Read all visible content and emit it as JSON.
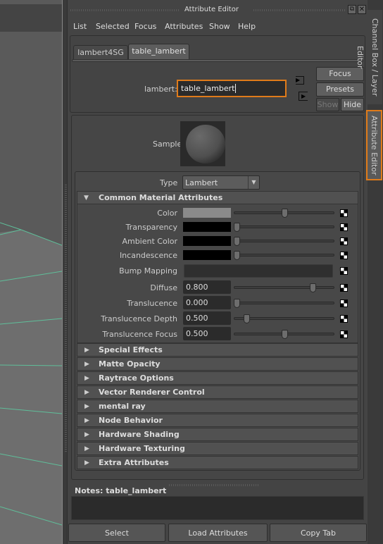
{
  "window": {
    "title": "Attribute Editor"
  },
  "menu": [
    "List",
    "Selected",
    "Focus",
    "Attributes",
    "Show",
    "Help"
  ],
  "tabs": [
    {
      "label": "lambert4SG",
      "active": false
    },
    {
      "label": "table_lambert",
      "active": true
    }
  ],
  "node": {
    "label": "lambert:",
    "value": "table_lambert"
  },
  "side_buttons": {
    "focus": "Focus",
    "presets": "Presets",
    "show": "Show",
    "hide": "Hide"
  },
  "sample": {
    "label": "Sample"
  },
  "type": {
    "label": "Type",
    "value": "Lambert"
  },
  "common": {
    "title": "Common Material Attributes",
    "expanded": true,
    "attributes": [
      {
        "label": "Color",
        "kind": "color",
        "swatch": "#8a8a8a",
        "slider": 0.5
      },
      {
        "label": "Transparency",
        "kind": "color",
        "swatch": "#000000",
        "slider": 0
      },
      {
        "label": "Ambient Color",
        "kind": "color",
        "swatch": "#000000",
        "slider": 0
      },
      {
        "label": "Incandescence",
        "kind": "color",
        "swatch": "#000000",
        "slider": 0
      },
      {
        "label": "Bump Mapping",
        "kind": "map"
      },
      {
        "label": "Diffuse",
        "kind": "number",
        "value": "0.800",
        "slider": 0.8
      },
      {
        "label": "Translucence",
        "kind": "number",
        "value": "0.000",
        "slider": 0
      },
      {
        "label": "Translucence Depth",
        "kind": "number",
        "value": "0.500",
        "slider": 0.1
      },
      {
        "label": "Translucence Focus",
        "kind": "number",
        "value": "0.500",
        "slider": 0.5
      }
    ]
  },
  "sections": [
    "Special Effects",
    "Matte Opacity",
    "Raytrace Options",
    "Vector Renderer Control",
    "mental ray",
    "Node Behavior",
    "Hardware Shading",
    "Hardware Texturing",
    "Extra Attributes"
  ],
  "notes": {
    "label": "Notes:  table_lambert",
    "value": ""
  },
  "bottom_buttons": [
    "Select",
    "Load Attributes",
    "Copy Tab"
  ],
  "right_tabs": [
    {
      "label": "Channel Box / Layer Editor",
      "active": false
    },
    {
      "label": "Attribute Editor",
      "active": true
    }
  ],
  "colors": {
    "accent": "#e07b1a",
    "wire": "#5fbf9a"
  }
}
